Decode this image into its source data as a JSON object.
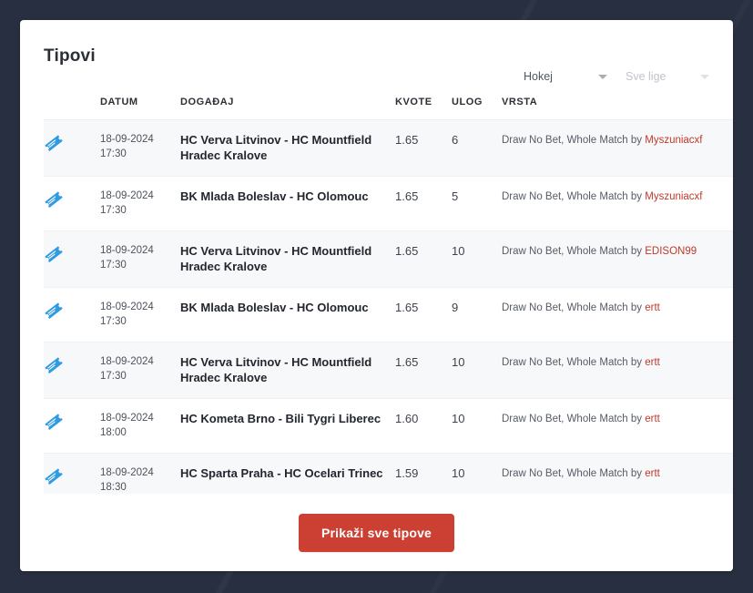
{
  "page": {
    "background_color": "#282f40",
    "card_background": "#ffffff"
  },
  "header": {
    "title": "Tipovi",
    "filters": {
      "sport": {
        "value": "Hokej",
        "icon": "chevron-down-icon"
      },
      "league": {
        "value": "Sve lige",
        "icon": "chevron-down-icon"
      }
    }
  },
  "table": {
    "columns": [
      "",
      "DATUM",
      "DOGAĐAJ",
      "KVOTE",
      "ULOG",
      "VRSTA"
    ],
    "rows": [
      {
        "icon": "ticket-icon",
        "date": "18-09-2024",
        "time": "17:30",
        "event": "HC Verva Litvinov - HC Mountfield Hradec Kralove",
        "odds": "1.65",
        "stake": "6",
        "type_prefix": "Draw No Bet, Whole Match by ",
        "user": "Myszuniacxf"
      },
      {
        "icon": "ticket-icon",
        "date": "18-09-2024",
        "time": "17:30",
        "event": "BK Mlada Boleslav - HC Olomouc",
        "odds": "1.65",
        "stake": "5",
        "type_prefix": "Draw No Bet, Whole Match by ",
        "user": "Myszuniacxf"
      },
      {
        "icon": "ticket-icon",
        "date": "18-09-2024",
        "time": "17:30",
        "event": "HC Verva Litvinov - HC Mountfield Hradec Kralove",
        "odds": "1.65",
        "stake": "10",
        "type_prefix": "Draw No Bet, Whole Match by ",
        "user": "EDISON99"
      },
      {
        "icon": "ticket-icon",
        "date": "18-09-2024",
        "time": "17:30",
        "event": "BK Mlada Boleslav - HC Olomouc",
        "odds": "1.65",
        "stake": "9",
        "type_prefix": "Draw No Bet, Whole Match by ",
        "user": "ertt"
      },
      {
        "icon": "ticket-icon",
        "date": "18-09-2024",
        "time": "17:30",
        "event": "HC Verva Litvinov - HC Mountfield Hradec Kralove",
        "odds": "1.65",
        "stake": "10",
        "type_prefix": "Draw No Bet, Whole Match by ",
        "user": "ertt"
      },
      {
        "icon": "ticket-icon",
        "date": "18-09-2024",
        "time": "18:00",
        "event": "HC Kometa Brno - Bili Tygri Liberec",
        "odds": "1.60",
        "stake": "10",
        "type_prefix": "Draw No Bet, Whole Match by ",
        "user": "ertt"
      },
      {
        "icon": "ticket-icon",
        "date": "18-09-2024",
        "time": "18:30",
        "event": "HC Sparta Praha - HC Ocelari Trinec",
        "odds": "1.59",
        "stake": "10",
        "type_prefix": "Draw No Bet, Whole Match by ",
        "user": "ertt"
      }
    ]
  },
  "footer": {
    "show_all_label": "Prikaži sve tipove",
    "button_color": "#cc4033"
  },
  "colors": {
    "user_link": "#c0392b",
    "ticket_icon": "#2f9be0",
    "accent_red": "#cc4033"
  }
}
